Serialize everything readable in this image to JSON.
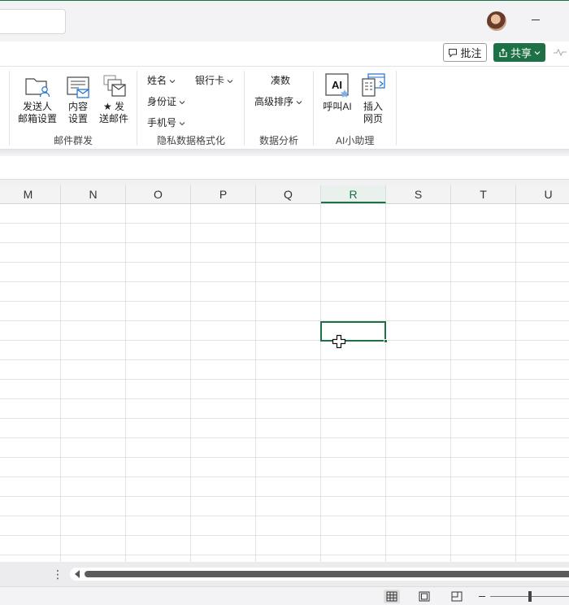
{
  "header": {
    "comment_label": "批注",
    "share_label": "共享"
  },
  "ribbon": {
    "mail_group": {
      "label": "邮件群发",
      "buttons": [
        {
          "line1": "发送人",
          "line2": "邮箱设置"
        },
        {
          "line1": "内容",
          "line2": "设置"
        },
        {
          "line1": "★ 发",
          "line2": "送邮件"
        }
      ]
    },
    "privacy_group": {
      "label": "隐私数据格式化",
      "items": [
        "姓名",
        "银行卡",
        "身份证",
        "手机号"
      ]
    },
    "analysis_group": {
      "label": "数据分析",
      "items": [
        "凑数",
        "高级排序"
      ]
    },
    "ai_group": {
      "label": "AI小助理",
      "icon_text": "AI",
      "buttons": [
        {
          "line1": "呼叫AI",
          "line2": ""
        },
        {
          "line1": "插入",
          "line2": "网页"
        }
      ]
    }
  },
  "sheet": {
    "columns": [
      "M",
      "N",
      "O",
      "P",
      "Q",
      "R",
      "S",
      "T",
      "U"
    ],
    "active_column": "R",
    "sheet_menu_icon": "⋮"
  },
  "colors": {
    "accent": "#1e7145"
  }
}
